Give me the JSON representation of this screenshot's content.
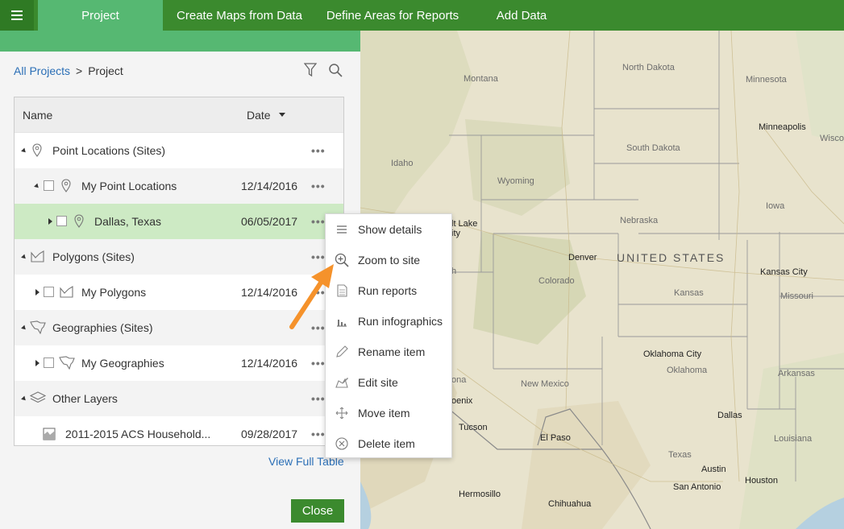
{
  "nav": {
    "tabs": [
      {
        "label": "Project"
      },
      {
        "label": "Create Maps from Data"
      },
      {
        "label": "Define Areas for Reports"
      },
      {
        "label": "Add Data"
      }
    ]
  },
  "breadcrumb": {
    "root": "All Projects",
    "sep": ">",
    "current": "Project"
  },
  "table": {
    "col_name": "Name",
    "col_date": "Date",
    "rows": [
      {
        "label": "Point Locations (Sites)",
        "date": ""
      },
      {
        "label": "My Point Locations",
        "date": "12/14/2016"
      },
      {
        "label": "Dallas, Texas",
        "date": "06/05/2017"
      },
      {
        "label": "Polygons (Sites)",
        "date": ""
      },
      {
        "label": "My Polygons",
        "date": "12/14/2016"
      },
      {
        "label": "Geographies (Sites)",
        "date": ""
      },
      {
        "label": "My Geographies",
        "date": "12/14/2016"
      },
      {
        "label": "Other Layers",
        "date": ""
      },
      {
        "label": "2011-2015 ACS Household...",
        "date": "09/28/2017"
      }
    ],
    "more": "•••"
  },
  "view_full": "View Full Table",
  "close_label": "Close",
  "menu": {
    "items": [
      {
        "label": "Show details",
        "icon": "list-icon"
      },
      {
        "label": "Zoom to site",
        "icon": "zoom-in-icon"
      },
      {
        "label": "Run reports",
        "icon": "report-icon"
      },
      {
        "label": "Run infographics",
        "icon": "bar-chart-icon"
      },
      {
        "label": "Rename item",
        "icon": "pencil-icon"
      },
      {
        "label": "Edit site",
        "icon": "edit-site-icon"
      },
      {
        "label": "Move item",
        "icon": "move-icon"
      },
      {
        "label": "Delete item",
        "icon": "delete-icon"
      }
    ]
  },
  "map": {
    "labels": {
      "north_dakota": "North Dakota",
      "montana": "Montana",
      "minnesota": "Minnesota",
      "minneapolis": "Minneapolis",
      "wisc": "Wisco",
      "south_dakota": "South Dakota",
      "idaho": "Idaho",
      "wyoming": "Wyoming",
      "iowa": "Iowa",
      "salt_lake": "lt Lake",
      "salt_lake2": "ity",
      "nebraska": "Nebraska",
      "denver": "Denver",
      "united_states": "UNITED STATES",
      "kansas_city": "Kansas City",
      "colorado": "Colorado",
      "kansas": "Kansas",
      "missouri": "Missouri",
      "utah_frag": "h",
      "oklahoma_city": "Oklahoma City",
      "oklahoma": "Oklahoma",
      "arkansas": "Arkansas",
      "arizona_frag": "ona",
      "new_mexico": "New Mexico",
      "phoenix": "oenix",
      "dallas": "Dallas",
      "tucson": "Tucson",
      "el_paso": "El Paso",
      "louisiana": "Louisiana",
      "texas": "Texas",
      "austin": "Austin",
      "san_antonio": "San Antonio",
      "houston": "Houston",
      "hermosillo": "Hermosillo",
      "chihuahua": "Chihuahua"
    }
  },
  "colors": {
    "brand_green": "#3b8a2e",
    "tab_active": "#56b872",
    "selected_row": "#cdeac4",
    "arrow": "#f5922b",
    "link": "#2b6fb6"
  }
}
